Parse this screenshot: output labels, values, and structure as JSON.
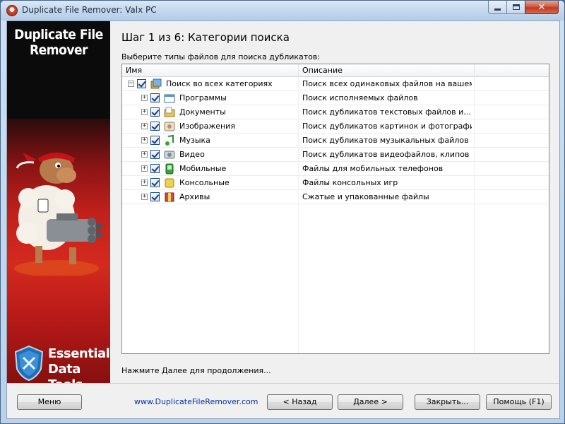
{
  "window": {
    "title": "Duplicate File Remover: Valx PC"
  },
  "sidebar": {
    "logo_line1": "Duplicate File",
    "logo_line2": "Remover",
    "brand_line1": "Essential",
    "brand_line2": "Data Tools"
  },
  "wizard": {
    "step_title": "Шаг 1 из 6: Категории поиска",
    "instruction": "Выберите типы файлов для поиска дубликатов:",
    "hint": "Нажмите Далее для продолжения..."
  },
  "grid": {
    "columns": [
      "Имя",
      "Описание"
    ],
    "rows": [
      {
        "name": "Поиск во всех категориях",
        "description": "Поиск всех одинаковых файлов на вашем...",
        "icon": "all-categories-icon",
        "level": 0,
        "checked": true
      },
      {
        "name": "Программы",
        "description": "Поиск исполняемых файлов",
        "icon": "programs-icon",
        "level": 1,
        "checked": true
      },
      {
        "name": "Документы",
        "description": "Поиск дубликатов текстовых файлов и...",
        "icon": "documents-icon",
        "level": 1,
        "checked": true
      },
      {
        "name": "Изображения",
        "description": "Поиск дубликатов картинок и фотографий",
        "icon": "images-icon",
        "level": 1,
        "checked": true
      },
      {
        "name": "Музыка",
        "description": "Поиск дубликатов музыкальных файлов",
        "icon": "music-icon",
        "level": 1,
        "checked": true
      },
      {
        "name": "Видео",
        "description": "Поиск дубликатов видеофайлов, клипов и...",
        "icon": "video-icon",
        "level": 1,
        "checked": true
      },
      {
        "name": "Мобильные",
        "description": "Файлы для мобильных телефонов",
        "icon": "mobile-icon",
        "level": 1,
        "checked": true
      },
      {
        "name": "Консольные",
        "description": "Файлы консольных игр",
        "icon": "console-icon",
        "level": 1,
        "checked": true
      },
      {
        "name": "Архивы",
        "description": "Сжатые и упакованные файлы",
        "icon": "archive-icon",
        "level": 1,
        "checked": true
      }
    ]
  },
  "footer": {
    "menu_label": "Меню",
    "website": "www.DuplicateFileRemover.com",
    "back_label": "< Назад",
    "next_label": "Далее >",
    "close_label": "Закрыть...",
    "help_label": "Помощь (F1)"
  }
}
